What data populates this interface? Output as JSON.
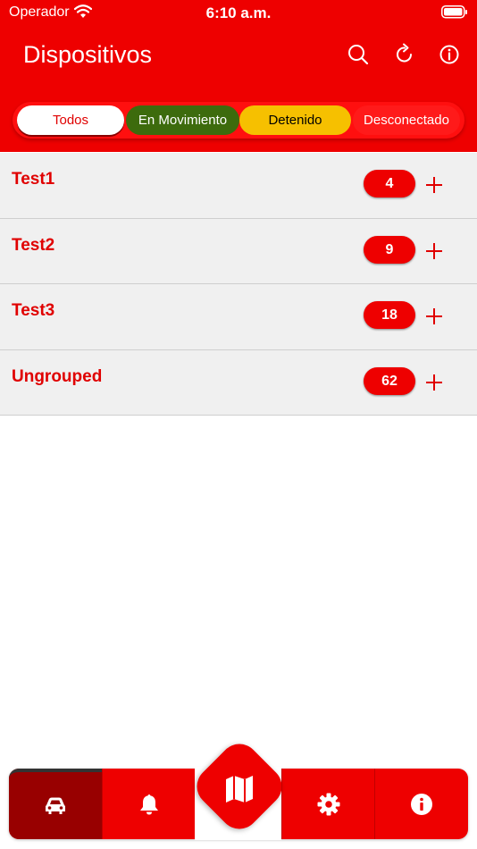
{
  "status_bar": {
    "carrier": "Operador",
    "time": "6:10 a.m."
  },
  "header": {
    "title": "Dispositivos"
  },
  "filters": {
    "all": "Todos",
    "moving": "En Movimiento",
    "stopped": "Detenido",
    "disconnected": "Desconectado"
  },
  "groups": [
    {
      "name": "Test1",
      "count": "4"
    },
    {
      "name": "Test2",
      "count": "9"
    },
    {
      "name": "Test3",
      "count": "18"
    },
    {
      "name": "Ungrouped",
      "count": "62"
    }
  ],
  "colors": {
    "brand_red": "#ee0000",
    "moving_green": "#3d6b0d",
    "stopped_yellow": "#f6c000",
    "active_tab": "#980000"
  },
  "tabbar": {
    "tabs": [
      "car-icon",
      "bell-icon",
      "map-icon",
      "gear-icon",
      "info-icon"
    ],
    "active": "car-icon"
  }
}
